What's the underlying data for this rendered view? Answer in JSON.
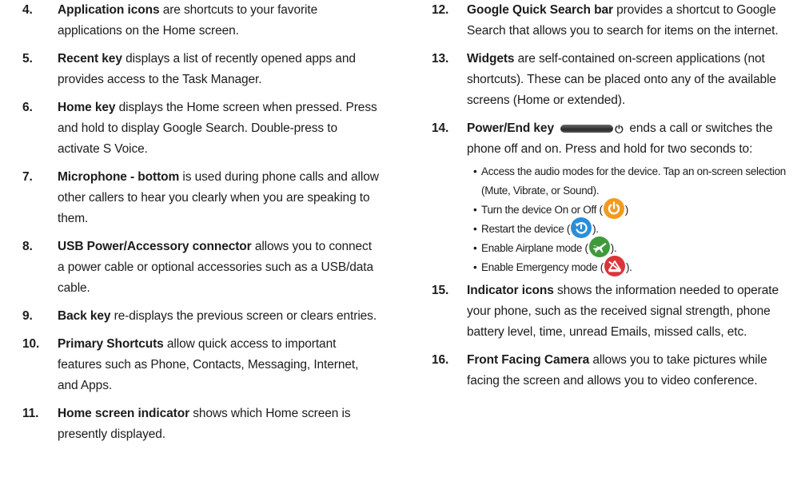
{
  "left_items": [
    {
      "num": "4.",
      "term": "Application icons",
      "text": " are shortcuts to your favorite applications on the Home screen."
    },
    {
      "num": "5.",
      "term": "Recent key",
      "text": " displays a list of recently opened apps and provides access to the Task Manager."
    },
    {
      "num": "6.",
      "term": "Home key",
      "text": " displays the Home screen when pressed. Press and hold to display Google Search. Double-press to activate S Voice."
    },
    {
      "num": "7.",
      "term": "Microphone - bottom",
      "text": " is used during phone calls and allow other callers to hear you clearly when you are speaking to them."
    },
    {
      "num": "8.",
      "term": "USB Power/Accessory connector",
      "text": " allows you to connect a power cable or optional accessories such as a USB/data cable."
    },
    {
      "num": "9.",
      "term": "Back key",
      "text": " re-displays the previous screen or clears entries."
    },
    {
      "num": "10.",
      "term": "Primary Shortcuts",
      "text": " allow quick access to important features such as Phone, Contacts, Messaging, Internet, and Apps."
    },
    {
      "num": "11.",
      "term": "Home screen indicator",
      "text": " shows which Home screen is presently displayed."
    }
  ],
  "right_items": {
    "i12": {
      "num": "12.",
      "term": "Google Quick Search bar",
      "text": " provides a shortcut to Google Search that allows you to search for items on the internet."
    },
    "i13": {
      "num": "13.",
      "term": "Widgets",
      "text": " are self-contained on-screen applications (not shortcuts). These can be placed onto any of the available screens (Home or extended)."
    },
    "i14": {
      "num": "14.",
      "term": "Power/End key",
      "text": " ends a call or switches the phone off and on. Press and hold for two seconds to:",
      "bullets": {
        "b1": "Access the audio modes for the device. Tap an on-screen selection (Mute, Vibrate, or Sound).",
        "b2_pre": "Turn the device On or Off  (",
        "b2_post": ")",
        "b3_pre": "Restart the device (",
        "b3_post": ").",
        "b4_pre": "Enable Airplane mode (",
        "b4_post": ").",
        "b5_pre": "Enable Emergency mode (",
        "b5_post": ")."
      }
    },
    "i15": {
      "num": "15.",
      "term": "Indicator icons",
      "text": " shows the information needed to operate your phone, such as the received signal strength, phone battery level, time, unread Emails, missed calls, etc."
    },
    "i16": {
      "num": "16.",
      "term": "Front Facing Camera",
      "text": " allows you to take pictures while facing the screen and allows you to video conference."
    }
  },
  "icons": {
    "power_key": "power-key-button-icon",
    "power_off": "power-icon",
    "restart": "restart-icon",
    "airplane": "airplane-mode-icon",
    "emergency": "emergency-mode-icon"
  },
  "colors": {
    "power_off": "#f39a1e",
    "restart": "#2a8fd8",
    "airplane": "#3f9a3c",
    "emergency": "#d9353a"
  },
  "bullet_char": "•"
}
